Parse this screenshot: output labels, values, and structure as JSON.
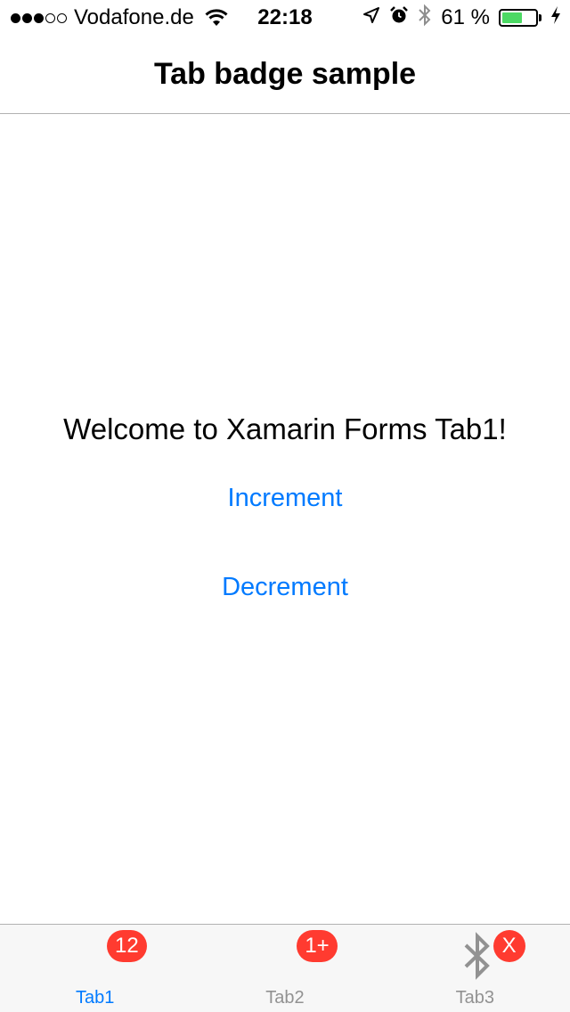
{
  "status_bar": {
    "signal_dots_filled": 3,
    "signal_dots_total": 5,
    "carrier": "Vodafone.de",
    "time": "22:18",
    "battery_percent_label": "61 %",
    "battery_level": 0.61,
    "battery_color": "#4cd964",
    "icons": [
      "wifi-icon",
      "location-icon",
      "alarm-icon",
      "bluetooth-icon",
      "charging-icon"
    ]
  },
  "nav": {
    "title": "Tab badge sample"
  },
  "main": {
    "welcome_text": "Welcome to Xamarin Forms Tab1!",
    "increment_label": "Increment",
    "decrement_label": "Decrement"
  },
  "tab_bar": {
    "tabs": [
      {
        "label": "Tab1",
        "badge": "12",
        "active": true
      },
      {
        "label": "Tab2",
        "badge": "1+",
        "active": false
      },
      {
        "label": "Tab3",
        "badge": "X",
        "active": false,
        "icon": "bluetooth-icon"
      }
    ]
  },
  "colors": {
    "accent": "#007aff",
    "badge": "#ff3b30",
    "tab_inactive": "#929292"
  }
}
